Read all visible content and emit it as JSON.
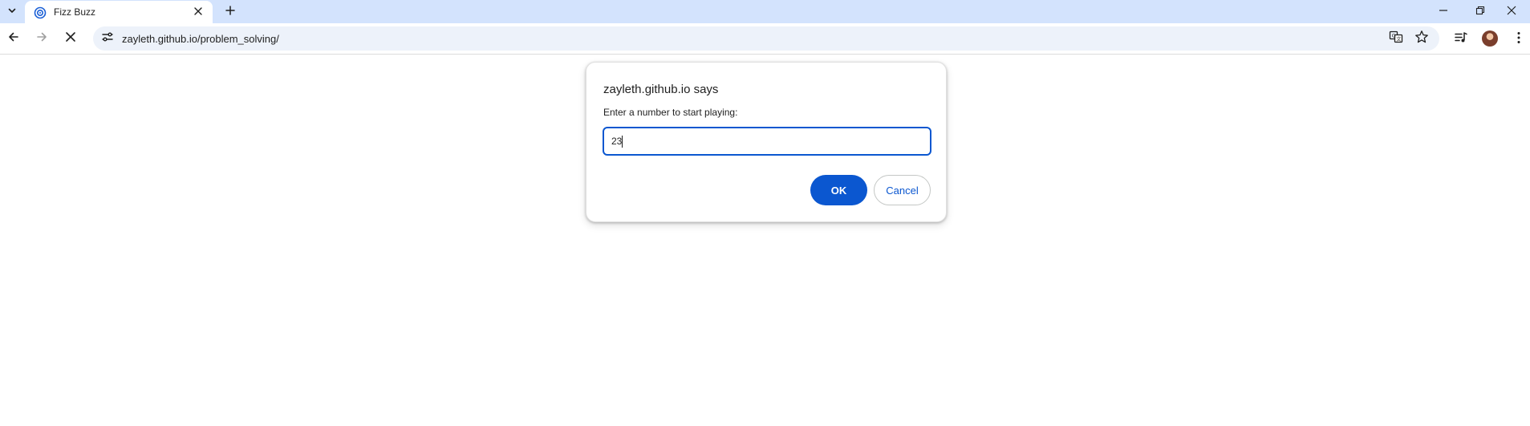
{
  "browser": {
    "tab": {
      "title": "Fizz Buzz",
      "favicon": "globe-swirl-icon"
    },
    "address_bar": {
      "url": "zayleth.github.io/problem_solving/"
    },
    "icons": {
      "tab_search": "chevron-down-icon",
      "tab_close": "close-icon",
      "new_tab": "plus-icon",
      "minimize": "minimize-icon",
      "restore": "restore-icon",
      "close_window": "close-icon",
      "back": "arrow-left-icon",
      "forward": "arrow-right-icon",
      "stop": "close-icon",
      "site_info": "tune-icon",
      "translate": "translate-icon",
      "bookmark": "star-icon",
      "media": "queue-music-icon",
      "profile": "avatar",
      "menu": "more-vertical-icon"
    },
    "colors": {
      "tabstrip": "#d3e3fd",
      "omnibox": "#edf2fa",
      "accent": "#0b57d0"
    }
  },
  "dialog": {
    "title": "zayleth.github.io says",
    "message": "Enter a number to start playing:",
    "input_value": "23",
    "ok_label": "OK",
    "cancel_label": "Cancel"
  }
}
